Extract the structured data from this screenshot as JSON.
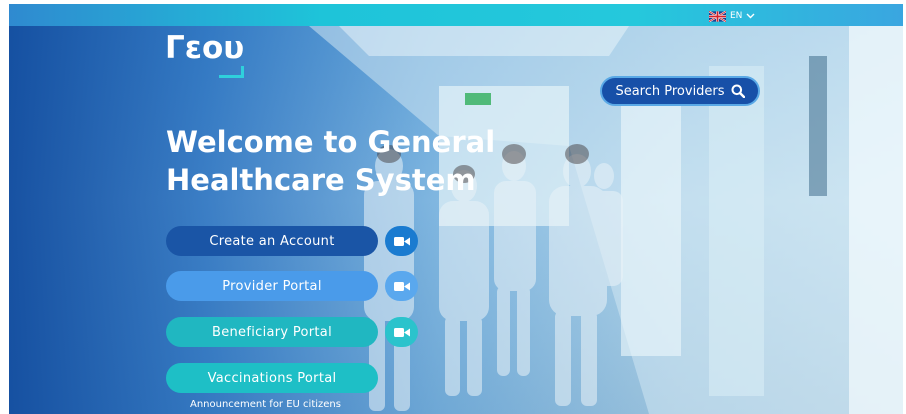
{
  "language": {
    "code": "EN"
  },
  "logo": {
    "text": "Γεου"
  },
  "search": {
    "label": "Search Providers"
  },
  "hero": {
    "title_line1": "Welcome to General",
    "title_line2": "Healthcare System"
  },
  "portals": [
    {
      "label": "Create an Account",
      "color": "#1a55a6"
    },
    {
      "label": "Provider Portal",
      "color": "#4a9bea"
    },
    {
      "label": "Beneficiary Portal",
      "color": "#20b7c1"
    },
    {
      "label": "Vaccinations Portal",
      "color": "#1ebfc6"
    }
  ],
  "announcement": {
    "text": "Announcement for EU citizens"
  },
  "colors": {
    "topbar": "#25c8dc",
    "accent": "#2fd0dc",
    "brand_blue": "#1750a8"
  },
  "icons": {
    "search": "magnifier-icon",
    "video": "video-camera-icon",
    "dropdown": "chevron-down-icon",
    "flag": "uk-flag-icon"
  }
}
